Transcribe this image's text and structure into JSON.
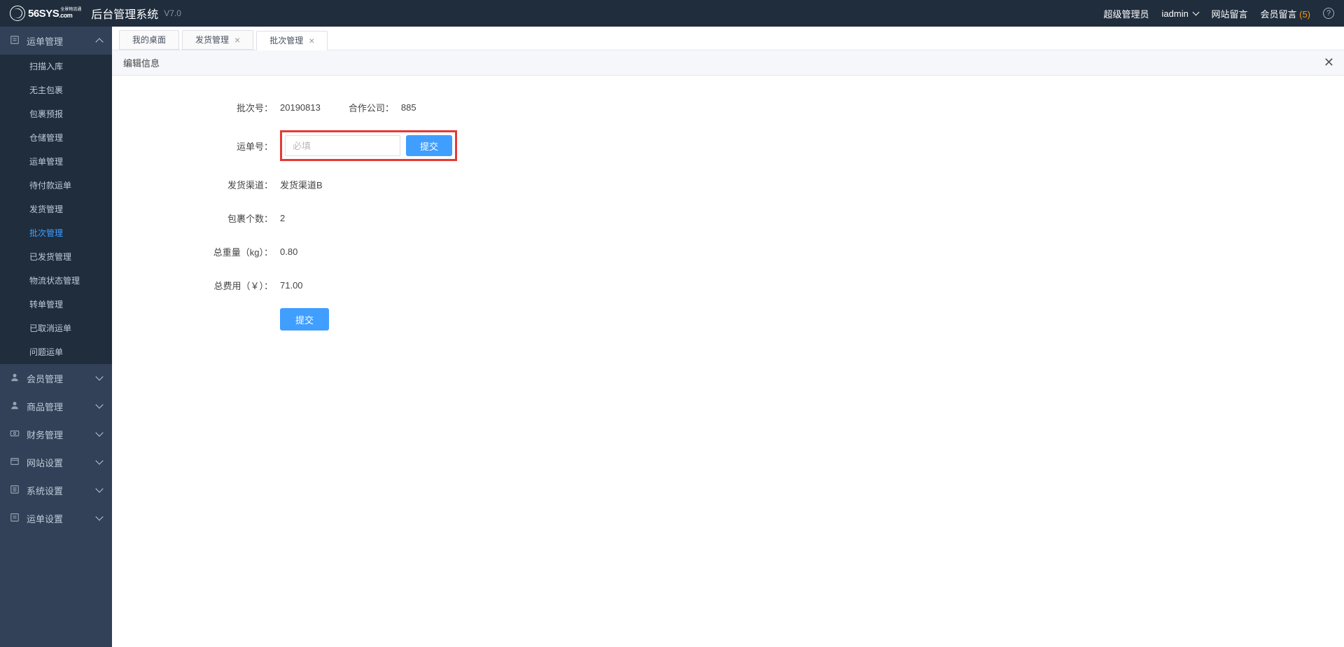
{
  "header": {
    "logo_main": "56SYS",
    "logo_tld": ".com",
    "logo_sub1": "全景物流通",
    "title": "后台管理系统",
    "version": "V7.0",
    "role": "超级管理员",
    "user": "iadmin",
    "site_msg": "网站留言",
    "member_msg": "会员留言",
    "member_msg_count": "(5)"
  },
  "sidebar": {
    "groups": [
      {
        "label": "运单管理",
        "icon": "doc",
        "expanded": true,
        "items": [
          {
            "label": "扫描入库"
          },
          {
            "label": "无主包裹"
          },
          {
            "label": "包裹预报"
          },
          {
            "label": "仓储管理"
          },
          {
            "label": "运单管理"
          },
          {
            "label": "待付款运单"
          },
          {
            "label": "发货管理"
          },
          {
            "label": "批次管理",
            "active": true
          },
          {
            "label": "已发货管理"
          },
          {
            "label": "物流状态管理"
          },
          {
            "label": "转单管理"
          },
          {
            "label": "已取消运单"
          },
          {
            "label": "问题运单"
          }
        ]
      },
      {
        "label": "会员管理",
        "icon": "user",
        "expanded": false
      },
      {
        "label": "商品管理",
        "icon": "user",
        "expanded": false
      },
      {
        "label": "财务管理",
        "icon": "money",
        "expanded": false
      },
      {
        "label": "网站设置",
        "icon": "site",
        "expanded": false
      },
      {
        "label": "系统设置",
        "icon": "gear",
        "expanded": false
      },
      {
        "label": "运单设置",
        "icon": "doc",
        "expanded": false
      }
    ]
  },
  "tabs": [
    {
      "label": "我的桌面",
      "closable": false,
      "active": false
    },
    {
      "label": "发货管理",
      "closable": true,
      "active": false
    },
    {
      "label": "批次管理",
      "closable": true,
      "active": true
    }
  ],
  "panel": {
    "title": "编辑信息"
  },
  "form": {
    "batch_label": "批次号：",
    "batch_value": "20190813",
    "company_label": "合作公司：",
    "company_value": "885",
    "waybill_label": "运单号：",
    "waybill_placeholder": "必填",
    "waybill_submit": "提交",
    "channel_label": "发货渠道：",
    "channel_value": "发货渠道B",
    "count_label": "包裹个数：",
    "count_value": "2",
    "weight_label": "总重量（kg）：",
    "weight_value": "0.80",
    "fee_label": "总费用（￥）：",
    "fee_value": "71.00",
    "submit": "提交"
  }
}
